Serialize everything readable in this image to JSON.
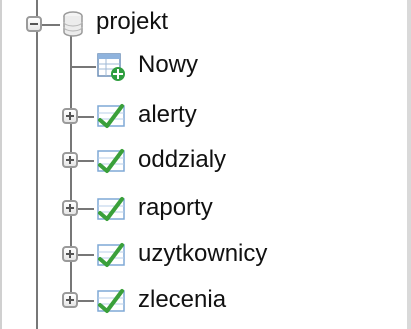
{
  "tree": {
    "root": {
      "label": "projekt",
      "icon": "database-icon",
      "expanded": true
    },
    "new_item": {
      "label": "Nowy",
      "icon": "new-table-icon"
    },
    "tables": [
      {
        "label": "alerty",
        "icon": "table-icon",
        "expanded": false
      },
      {
        "label": "oddzialy",
        "icon": "table-icon",
        "expanded": false
      },
      {
        "label": "raporty",
        "icon": "table-icon",
        "expanded": false
      },
      {
        "label": "uzytkownicy",
        "icon": "table-icon",
        "expanded": false
      },
      {
        "label": "zlecenia",
        "icon": "table-icon",
        "expanded": false
      }
    ]
  },
  "colors": {
    "connector": "#777777",
    "table_icon_green": "#3aa03a",
    "table_icon_blue": "#7fa8d6"
  }
}
